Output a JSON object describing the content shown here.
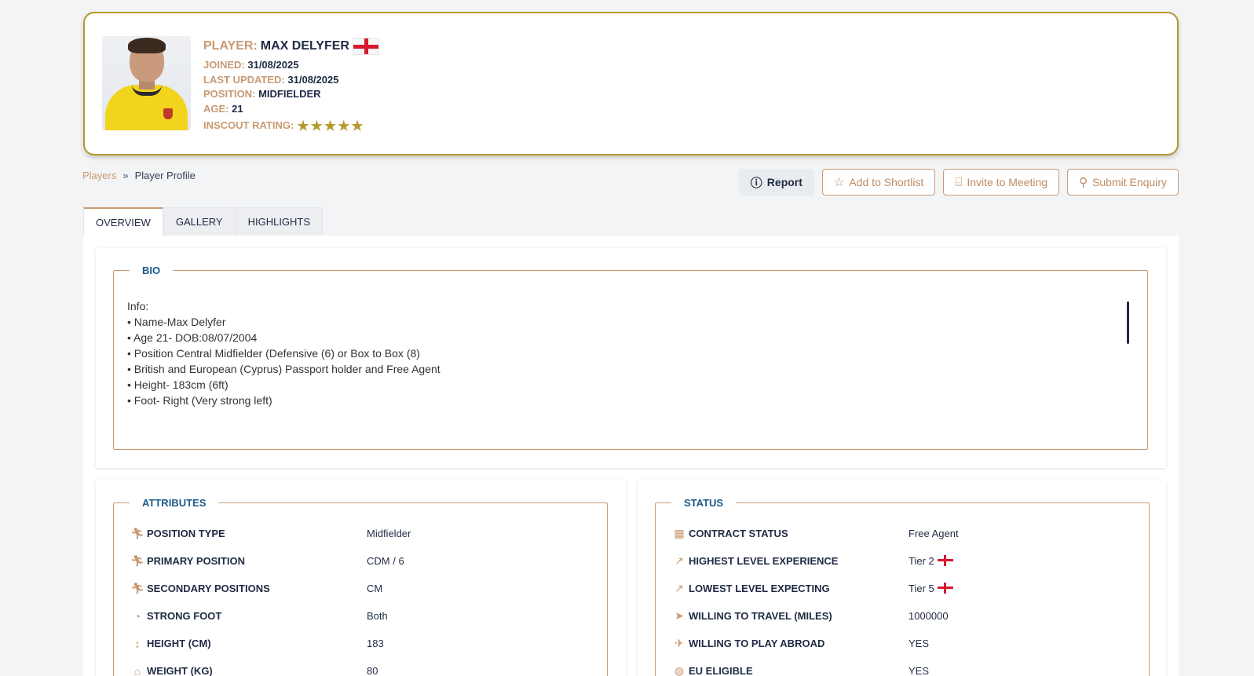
{
  "player": {
    "title_key": "PLAYER:",
    "name": "MAX DELYFER",
    "joined_key": "JOINED:",
    "joined": "31/08/2025",
    "updated_key": "LAST UPDATED:",
    "updated": "31/08/2025",
    "position_key": "POSITION:",
    "position": "MIDFIELDER",
    "age_key": "AGE:",
    "age": "21",
    "rating_key": "INSCOUT RATING:",
    "rating_stars": 5,
    "rating_max": 5
  },
  "breadcrumb": {
    "link": "Players",
    "separator": "»",
    "current": "Player Profile"
  },
  "actions": {
    "report": "Report",
    "shortlist": "Add to Shortlist",
    "meeting": "Invite to Meeting",
    "enquiry": "Submit Enquiry"
  },
  "tabs": {
    "overview": "OVERVIEW",
    "gallery": "GALLERY",
    "highlights": "HIGHLIGHTS"
  },
  "bio": {
    "legend": "BIO",
    "lines": [
      "Info:",
      "• Name-Max Delyfer",
      "• Age 21- DOB:08/07/2004",
      "• Position Central Midfielder (Defensive (6) or Box to Box (8)",
      "• British and European (Cyprus) Passport holder and Free Agent",
      "• Height- 183cm (6ft)",
      "• Foot- Right (Very strong left)"
    ]
  },
  "attributes": {
    "legend": "ATTRIBUTES",
    "rows": [
      {
        "icon": "runner-icon",
        "label": "POSITION TYPE",
        "value": "Midfielder"
      },
      {
        "icon": "runner-icon",
        "label": "PRIMARY POSITION",
        "value": "CDM / 6"
      },
      {
        "icon": "runner-icon",
        "label": "SECONDARY POSITIONS",
        "value": "CM"
      },
      {
        "icon": "footprint-icon",
        "label": "STRONG FOOT",
        "value": "Both"
      },
      {
        "icon": "height-icon",
        "label": "HEIGHT (CM)",
        "value": "183"
      },
      {
        "icon": "weight-icon",
        "label": "WEIGHT (KG)",
        "value": "80"
      }
    ]
  },
  "status": {
    "legend": "STATUS",
    "rows": [
      {
        "icon": "calendar-icon",
        "label": "CONTRACT STATUS",
        "value": "Free Agent"
      },
      {
        "icon": "chart-icon",
        "label": "HIGHEST LEVEL EXPERIENCE",
        "value": "Tier 2"
      },
      {
        "icon": "chart-icon",
        "label": "LOWEST LEVEL EXPECTING",
        "value": "Tier 5"
      },
      {
        "icon": "send-icon",
        "label": "WILLING TO TRAVEL (MILES)",
        "value": "1000000"
      },
      {
        "icon": "plane-icon",
        "label": "WILLING TO PLAY ABROAD",
        "value": "YES"
      },
      {
        "icon": "globe-icon",
        "label": "EU ELIGIBLE",
        "value": "YES"
      }
    ]
  },
  "colors": {
    "accent": "#c99a72",
    "gold": "#b49a2e",
    "navy": "#1f2a44",
    "legend": "#1a5a8a"
  }
}
